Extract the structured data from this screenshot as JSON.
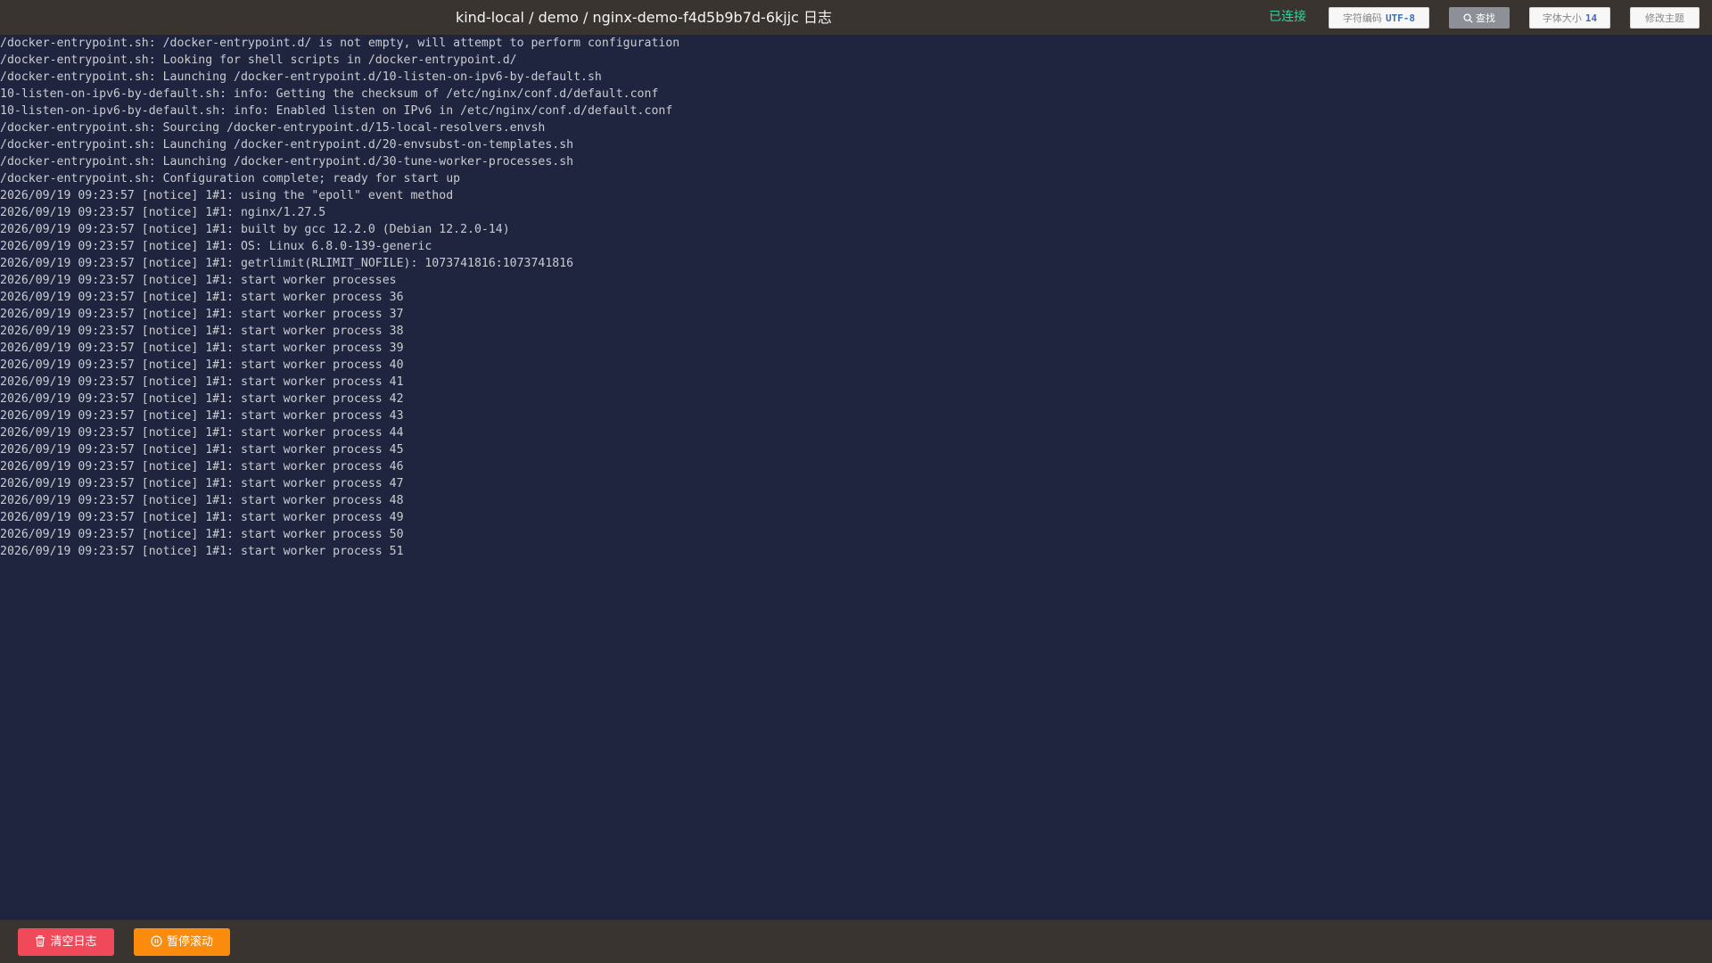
{
  "header": {
    "title": "kind-local / demo / nginx-demo-f4d5b9b7d-6kjjc 日志",
    "status": "已连接",
    "encoding_label": "字符编码",
    "encoding_value": "UTF-8",
    "search_label": "查找",
    "font_size_label": "字体大小",
    "font_size_value": "14",
    "theme_label": "修改主题"
  },
  "colors": {
    "background": "#20253f",
    "bar": "#3a3430",
    "status": "#2fd4a0",
    "clear_button": "#f0495a",
    "pause_button": "#fb8b0c"
  },
  "log": {
    "lines": [
      "/docker-entrypoint.sh: /docker-entrypoint.d/ is not empty, will attempt to perform configuration",
      "/docker-entrypoint.sh: Looking for shell scripts in /docker-entrypoint.d/",
      "/docker-entrypoint.sh: Launching /docker-entrypoint.d/10-listen-on-ipv6-by-default.sh",
      "10-listen-on-ipv6-by-default.sh: info: Getting the checksum of /etc/nginx/conf.d/default.conf",
      "10-listen-on-ipv6-by-default.sh: info: Enabled listen on IPv6 in /etc/nginx/conf.d/default.conf",
      "/docker-entrypoint.sh: Sourcing /docker-entrypoint.d/15-local-resolvers.envsh",
      "/docker-entrypoint.sh: Launching /docker-entrypoint.d/20-envsubst-on-templates.sh",
      "/docker-entrypoint.sh: Launching /docker-entrypoint.d/30-tune-worker-processes.sh",
      "/docker-entrypoint.sh: Configuration complete; ready for start up",
      "2026/09/19 09:23:57 [notice] 1#1: using the \"epoll\" event method",
      "2026/09/19 09:23:57 [notice] 1#1: nginx/1.27.5",
      "2026/09/19 09:23:57 [notice] 1#1: built by gcc 12.2.0 (Debian 12.2.0-14)",
      "2026/09/19 09:23:57 [notice] 1#1: OS: Linux 6.8.0-139-generic",
      "2026/09/19 09:23:57 [notice] 1#1: getrlimit(RLIMIT_NOFILE): 1073741816:1073741816",
      "2026/09/19 09:23:57 [notice] 1#1: start worker processes",
      "2026/09/19 09:23:57 [notice] 1#1: start worker process 36",
      "2026/09/19 09:23:57 [notice] 1#1: start worker process 37",
      "2026/09/19 09:23:57 [notice] 1#1: start worker process 38",
      "2026/09/19 09:23:57 [notice] 1#1: start worker process 39",
      "2026/09/19 09:23:57 [notice] 1#1: start worker process 40",
      "2026/09/19 09:23:57 [notice] 1#1: start worker process 41",
      "2026/09/19 09:23:57 [notice] 1#1: start worker process 42",
      "2026/09/19 09:23:57 [notice] 1#1: start worker process 43",
      "2026/09/19 09:23:57 [notice] 1#1: start worker process 44",
      "2026/09/19 09:23:57 [notice] 1#1: start worker process 45",
      "2026/09/19 09:23:57 [notice] 1#1: start worker process 46",
      "2026/09/19 09:23:57 [notice] 1#1: start worker process 47",
      "2026/09/19 09:23:57 [notice] 1#1: start worker process 48",
      "2026/09/19 09:23:57 [notice] 1#1: start worker process 49",
      "2026/09/19 09:23:57 [notice] 1#1: start worker process 50",
      "2026/09/19 09:23:57 [notice] 1#1: start worker process 51"
    ]
  },
  "footer": {
    "clear_label": "清空日志",
    "clear_icon": "trash-icon",
    "pause_label": "暂停滚动",
    "pause_icon": "pause-circle-icon"
  }
}
